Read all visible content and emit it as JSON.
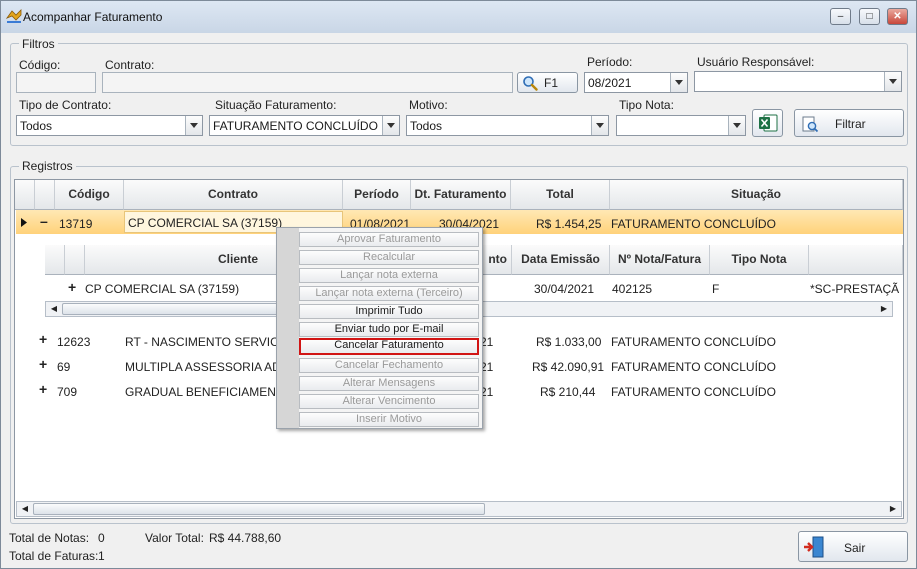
{
  "window": {
    "title": "Acompanhar Faturamento"
  },
  "filters": {
    "legend": "Filtros",
    "codigo_label": "Código:",
    "contrato_label": "Contrato:",
    "f1_label": "F1",
    "periodo_label": "Período:",
    "periodo_value": "08/2021",
    "usuario_label": "Usuário Responsável:",
    "usuario_value": "",
    "tipo_contrato_label": "Tipo de Contrato:",
    "tipo_contrato_value": "Todos",
    "situacao_label": "Situação Faturamento:",
    "situacao_value": "FATURAMENTO CONCLUÍDO",
    "motivo_label": "Motivo:",
    "motivo_value": "Todos",
    "tipo_nota_label": "Tipo Nota:",
    "tipo_nota_value": "",
    "filtrar_label": "Filtrar"
  },
  "registros": {
    "legend": "Registros",
    "columns": [
      "Código",
      "Contrato",
      "Período",
      "Dt. Faturamento",
      "Total",
      "Situação"
    ],
    "expanded_row": {
      "codigo": "13719",
      "contrato": "CP COMERCIAL SA (37159)",
      "periodo": "01/08/2021",
      "dt_faturamento": "30/04/2021",
      "total": "R$ 1.454,25",
      "situacao": "FATURAMENTO CONCLUÍDO"
    },
    "sub_columns": [
      "Cliente",
      "nto",
      "Data Emissão",
      "Nº Nota/Fatura",
      "Tipo Nota"
    ],
    "sub_row": {
      "cliente": "CP COMERCIAL SA (37159)",
      "data_emissao": "30/04/2021",
      "nota": "402125",
      "tipo_nota": "F",
      "extra": "*SC-PRESTAÇÃ"
    },
    "rows": [
      {
        "codigo": "12623",
        "contrato": "RT - NASCIMENTO SERVICO",
        "periodo_tail": "21",
        "total": "R$ 1.033,00",
        "situacao": "FATURAMENTO CONCLUÍDO"
      },
      {
        "codigo": "69",
        "contrato": "MULTIPLA ASSESSORIA ADU",
        "periodo_tail": "21",
        "total": "R$ 42.090,91",
        "situacao": "FATURAMENTO CONCLUÍDO"
      },
      {
        "codigo": "709",
        "contrato": "GRADUAL BENEFICIAMENTO",
        "periodo_tail": "21",
        "total": "R$ 210,44",
        "situacao": "FATURAMENTO CONCLUÍDO"
      }
    ]
  },
  "context_menu": {
    "items": [
      {
        "label": "Aprovar Faturamento",
        "enabled": false
      },
      {
        "label": "Recalcular",
        "enabled": false
      },
      {
        "label": "Lançar nota externa",
        "enabled": false
      },
      {
        "label": "Lançar nota externa (Terceiro)",
        "enabled": false
      },
      {
        "label": "Imprimir Tudo",
        "enabled": true
      },
      {
        "label": "Enviar tudo por E-mail",
        "enabled": true
      },
      {
        "label": "Cancelar Faturamento",
        "enabled": true,
        "selected": true
      },
      {
        "label": "Cancelar Fechamento",
        "enabled": false
      },
      {
        "label": "Alterar Mensagens",
        "enabled": false
      },
      {
        "label": "Alterar Vencimento",
        "enabled": false
      },
      {
        "label": "Inserir Motivo",
        "enabled": false
      }
    ]
  },
  "footer": {
    "total_notas_label": "Total de Notas:",
    "total_notas_value": "0",
    "valor_total_label": "Valor Total:",
    "valor_total_value": "R$ 44.788,60",
    "total_faturas_label": "Total de Faturas:",
    "total_faturas_value": "1",
    "sair_label": "Sair"
  },
  "colors": {
    "highlight": "#ffd27a",
    "selected_border": "#d11414"
  }
}
